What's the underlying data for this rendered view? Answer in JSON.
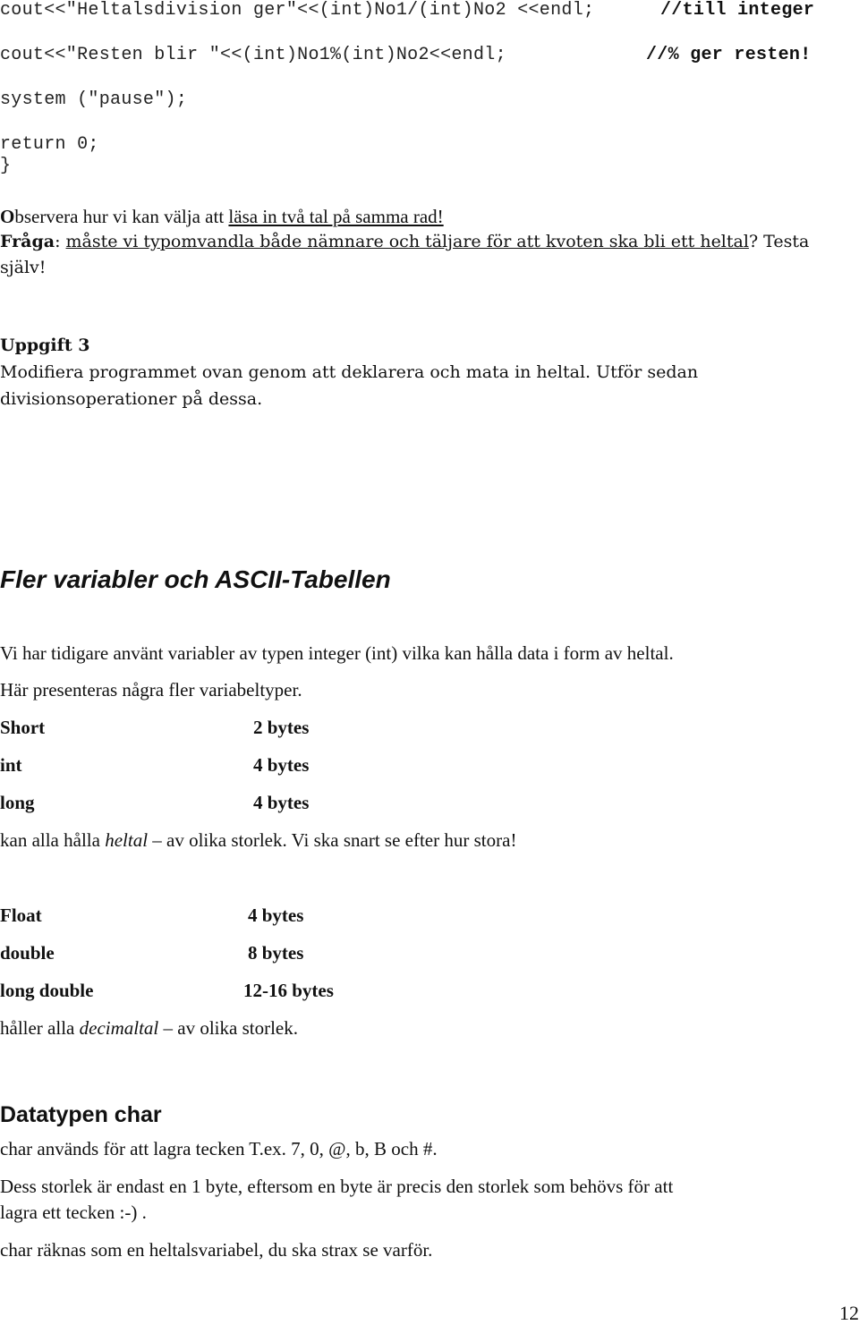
{
  "code": {
    "line1": "cout<<\"Heltalsdivision ger\"<<(int)No1/(int)No2 <<endl;",
    "line1_comment": "//till integer",
    "line2": "cout<<\"Resten blir \"<<(int)No1%(int)No2<<endl;",
    "line2_comment": "//% ger resten!",
    "line3": "system (\"pause\");",
    "line4": "return 0;",
    "line5": "}"
  },
  "observe": {
    "first_letter": "O",
    "text": "bservera hur vi kan välja att ",
    "underlined": "läsa in två tal på samma rad!"
  },
  "question": {
    "label": "Fråga",
    "colon": ": ",
    "underlined": "måste vi typomvandla både nämnare och täljare för att kvoten ska bli ett heltal",
    "tail": "? Testa",
    "line2": "själv!"
  },
  "task": {
    "title": "Uppgift 3",
    "line1": "Modifiera programmet ovan genom att deklarera och mata in heltal. Utför sedan",
    "line2": "divisionsoperationer på dessa."
  },
  "section1": {
    "heading": "Fler variabler och ASCII-Tabellen",
    "para1": "Vi har tidigare använt variabler av typen integer (int) vilka kan hålla data i form av heltal.",
    "para2": "Här presenteras några fler variabeltyper.",
    "integer_types": [
      {
        "name": "Short",
        "size": "2 bytes"
      },
      {
        "name": "int",
        "size": "4 bytes"
      },
      {
        "name": "long",
        "size": "4 bytes"
      }
    ],
    "integer_note": {
      "pre": "kan alla hålla ",
      "italic": "heltal",
      "post": " – av olika storlek. Vi ska snart se efter hur stora!"
    },
    "float_types": [
      {
        "name": "Float",
        "size": "4 bytes"
      },
      {
        "name": "double",
        "size": "8 bytes"
      },
      {
        "name": "long double",
        "size": "12-16 bytes"
      }
    ],
    "float_note": {
      "pre": "håller alla ",
      "italic": "decimaltal",
      "post": " – av olika storlek."
    }
  },
  "section2": {
    "heading": "Datatypen char",
    "para1": "char används för att lagra tecken T.ex. 7, 0, @, b, B och #.",
    "para2_line1": "Dess storlek är endast en 1 byte, eftersom en byte är precis den storlek som behövs för att",
    "para2_line2": "lagra ett tecken :-) .",
    "para3": "char räknas som en heltalsvariabel, du ska strax se varför."
  },
  "page_number": "12"
}
